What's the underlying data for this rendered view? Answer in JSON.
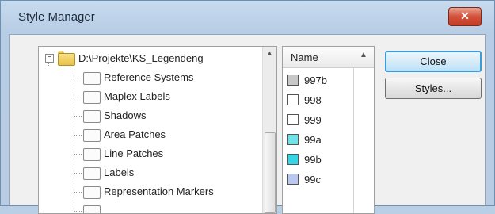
{
  "window": {
    "title": "Style Manager",
    "close_glyph": "✕"
  },
  "tree": {
    "root_label": "D:\\Projekte\\KS_Legendeng",
    "expander": "−",
    "items": [
      "Reference Systems",
      "Maplex Labels",
      "Shadows",
      "Area Patches",
      "Line Patches",
      "Labels",
      "Representation Markers"
    ]
  },
  "list": {
    "column_header": "Name",
    "sort_glyph": "▲",
    "items": [
      {
        "label": "997b",
        "color": "#c8c8c8"
      },
      {
        "label": "998",
        "color": "#ffffff"
      },
      {
        "label": "999",
        "color": "#ffffff"
      },
      {
        "label": "99a",
        "color": "#6fe3e8"
      },
      {
        "label": "99b",
        "color": "#34d6e6"
      },
      {
        "label": "99c",
        "color": "#b8c8f0"
      }
    ]
  },
  "buttons": {
    "close_label": "Close",
    "styles_label": "Styles..."
  }
}
